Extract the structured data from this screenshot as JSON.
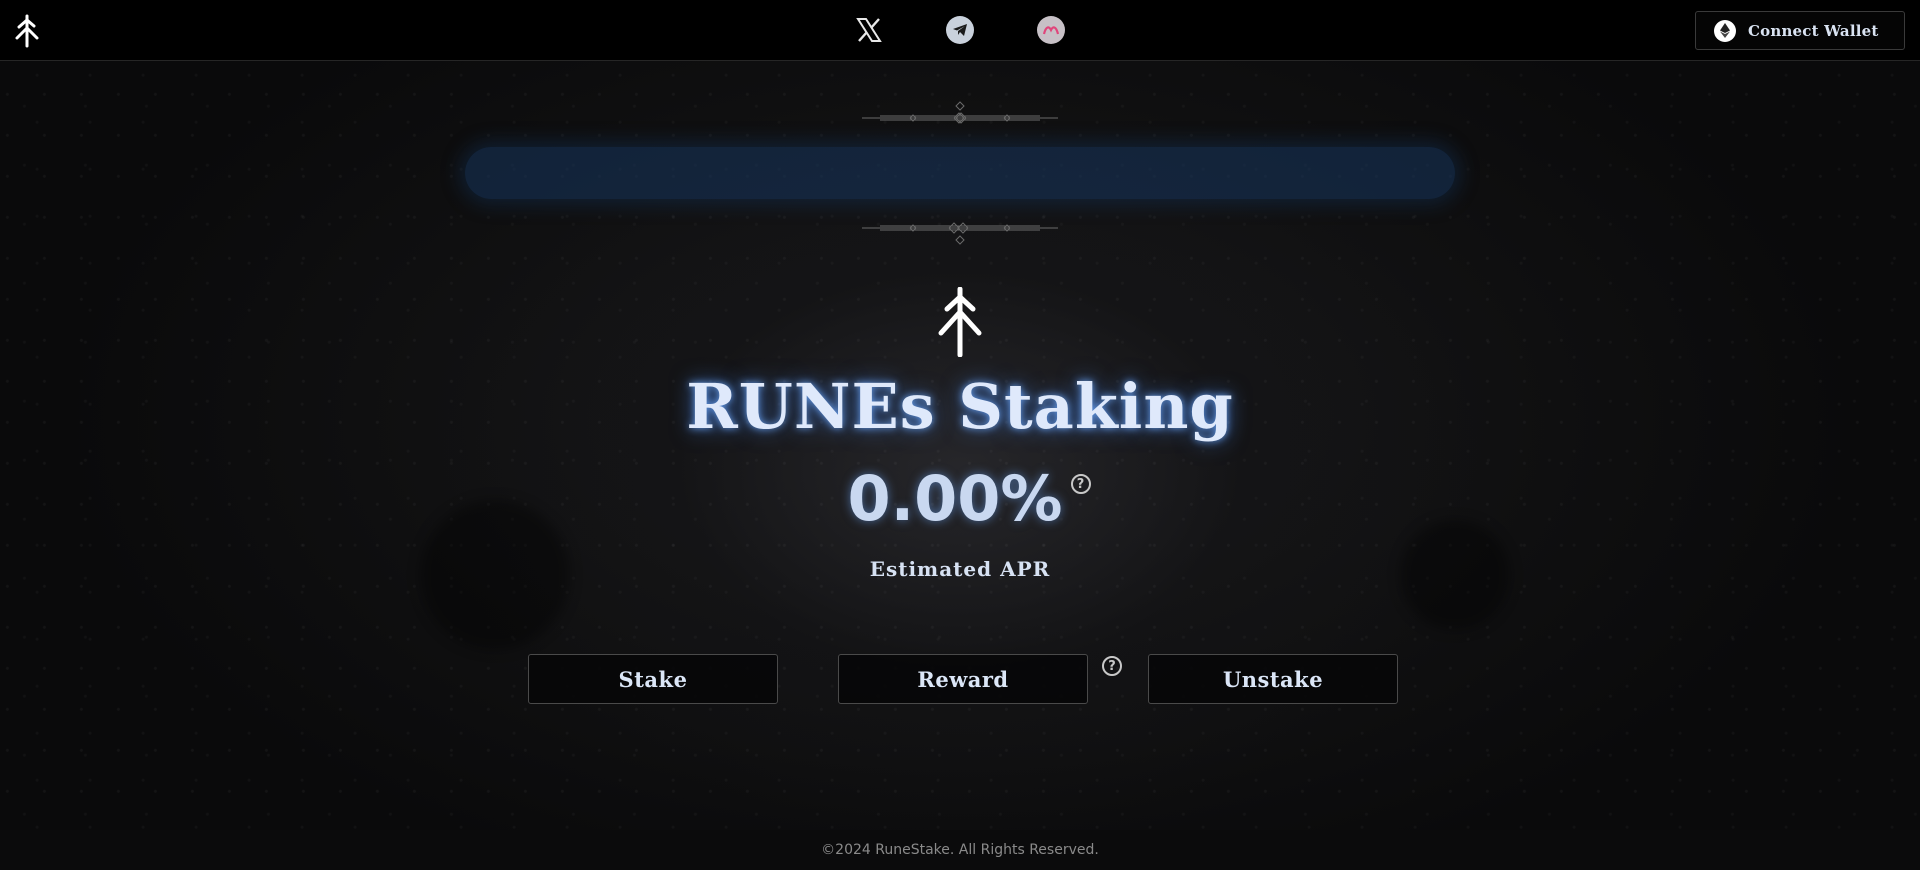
{
  "header": {
    "wallet_button_label": "Connect Wallet",
    "social_links": [
      {
        "icon": "x-logo-icon"
      },
      {
        "icon": "telegram-icon"
      },
      {
        "icon": "magic-eden-icon"
      }
    ]
  },
  "hero": {
    "title": "RUNEs Staking",
    "apr_value": "0.00%",
    "apr_label": "Estimated APR"
  },
  "actions": {
    "stake_label": "Stake",
    "reward_label": "Reward",
    "unstake_label": "Unstake"
  },
  "footer": {
    "copyright": "©2024 RuneStake. All Rights Reserved."
  },
  "colors": {
    "background": "#0d0d0e",
    "header": "#000000",
    "glow_blue": "#16345c",
    "title_text": "#dfe9fb"
  }
}
